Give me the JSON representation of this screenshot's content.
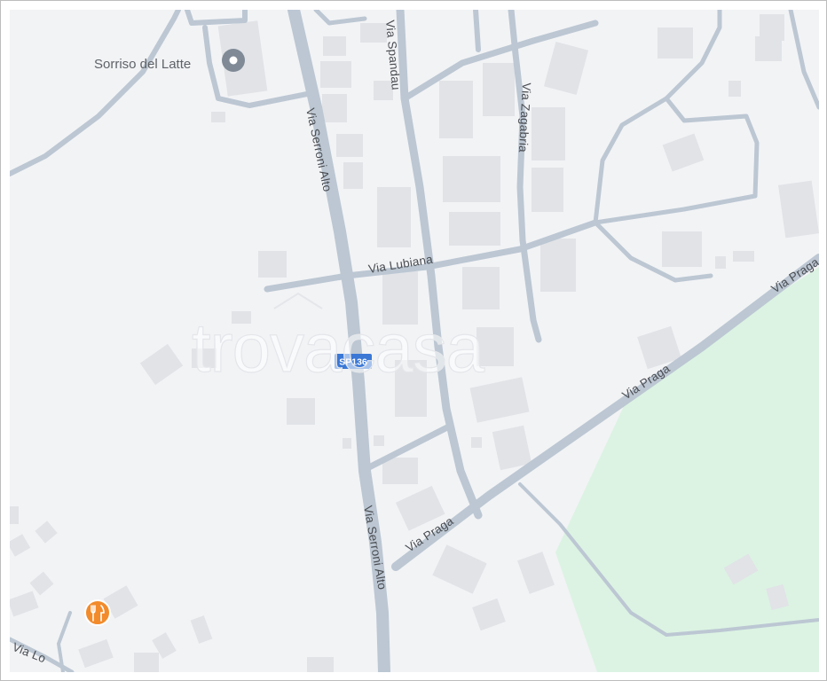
{
  "map": {
    "colors": {
      "background": "#f2f3f5",
      "road": "#bcc7d3",
      "building": "#e1e3e7",
      "park": "#dcf3e3",
      "shield": "#3b78d6",
      "restaurant_pin": "#f28b2b"
    },
    "roads": {
      "via_serroni_alto": "Via Serroni Alto",
      "via_spandau": "Via Spandau",
      "via_zagabria": "Via Zagabria",
      "via_lubiana": "Via Lubiana",
      "via_praga": "Via Praga",
      "via_lo_partial": "Via Lo"
    },
    "shield": {
      "label": "SP136"
    },
    "poi": {
      "name": "Sorriso del Latte",
      "icon": "location-pin-icon"
    },
    "restaurant": {
      "icon": "fork-knife-icon"
    },
    "watermark": "trovacasa"
  }
}
